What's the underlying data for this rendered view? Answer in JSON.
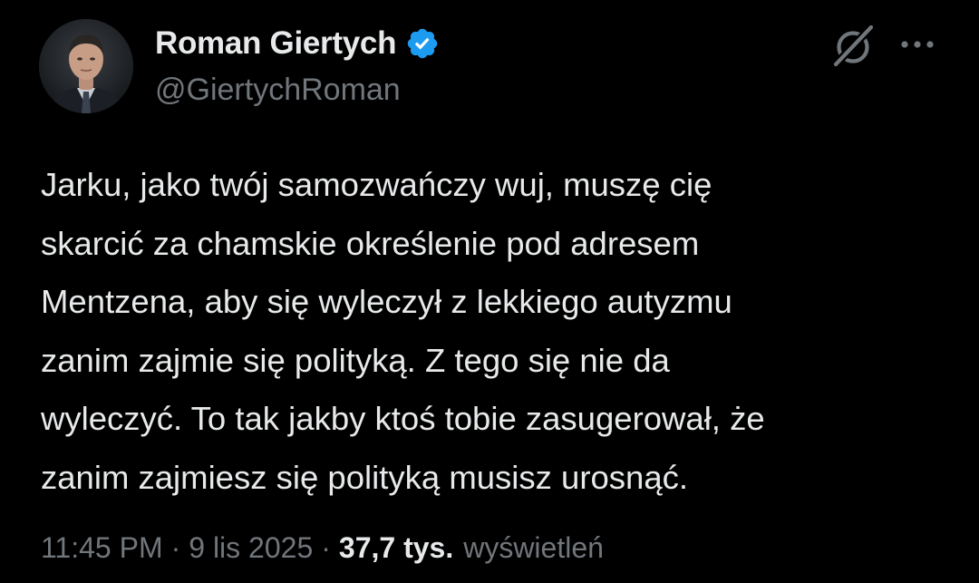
{
  "author": {
    "display_name": "Roman Giertych",
    "handle": "@GiertychRoman",
    "verified": true
  },
  "icons": {
    "verified": "verified-badge-icon",
    "grok": "grok-icon",
    "more": "more-options-icon"
  },
  "colors": {
    "background": "#000000",
    "primary_text": "#e7e9ea",
    "secondary_text": "#71767b",
    "verified_badge": "#1d9bf0"
  },
  "tweet": {
    "lines": [
      "Jarku, jako twój samozwańczy wuj, muszę cię",
      "skarcić za chamskie określenie pod adresem",
      "Mentzena, aby się wyleczył z lekkiego autyzmu",
      "zanim zajmie się polityką. Z tego się nie da",
      "wyleczyć. To tak jakby ktoś tobie zasugerował, że",
      "zanim zajmiesz się polityką musisz urosnąć."
    ]
  },
  "meta": {
    "time": "11:45 PM",
    "separator": "·",
    "date": "9 lis 2025",
    "views_count": "37,7 tys.",
    "views_label": "wyświetleń"
  }
}
